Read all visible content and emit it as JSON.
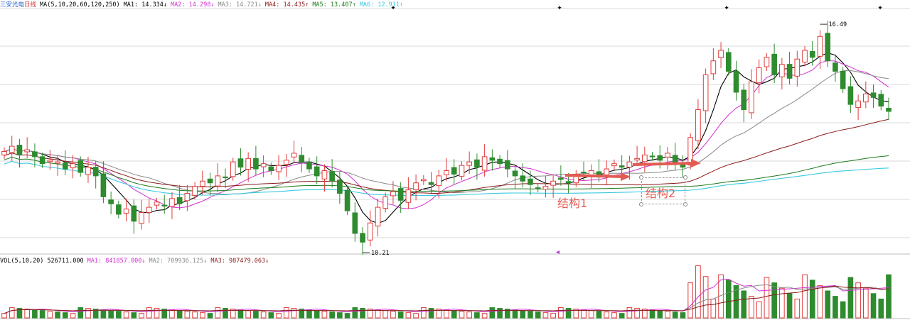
{
  "price_header": {
    "stock_name": "三安光电",
    "period": "日线",
    "ma_def": "MA(5,10,20,60,120,250)",
    "items": [
      {
        "label": "MA1: 14.334",
        "arrow": "↓",
        "color": "#000000"
      },
      {
        "label": "MA2: 14.298",
        "arrow": "↓",
        "color": "#d22fd2"
      },
      {
        "label": "MA3: 14.721",
        "arrow": "↓",
        "color": "#888888"
      },
      {
        "label": "MA4: 14.435",
        "arrow": "↑",
        "color": "#8b1a1a"
      },
      {
        "label": "MA5: 13.407",
        "arrow": "↑",
        "color": "#1b7a1b"
      },
      {
        "label": "MA6: 12.911",
        "arrow": "↑",
        "color": "#39c9e0"
      }
    ]
  },
  "vol_header": {
    "def": "VOL(5,10,20)",
    "value": "526711.000",
    "items": [
      {
        "label": "MA1: 841857.000",
        "arrow": "↓",
        "color": "#d22fd2"
      },
      {
        "label": "MA2: 709936.125",
        "arrow": "↓",
        "color": "#888888"
      },
      {
        "label": "MA3: 987479.063",
        "arrow": "↓",
        "color": "#8b1a1a"
      }
    ]
  },
  "annotations": {
    "structure1": "结构1",
    "structure2": "结构2",
    "high_label": "16.49",
    "low_label": "10.21"
  },
  "colors": {
    "up": "#e23b3b",
    "down": "#2e8b2e",
    "ma1": "#000000",
    "ma2": "#d22fd2",
    "ma3": "#888888",
    "ma4": "#8b1a1a",
    "ma5": "#1b7a1b",
    "ma6": "#39c9e0",
    "arrow": "#e35b52",
    "grid": "#d8d8d8"
  },
  "chart_data": {
    "type": "candlestick",
    "price_range": [
      10.0,
      17.0
    ],
    "candles_close": [
      12.9,
      13.05,
      12.8,
      12.95,
      12.75,
      12.55,
      12.65,
      12.6,
      12.4,
      12.55,
      12.3,
      12.45,
      12.2,
      11.6,
      11.4,
      11.1,
      11.25,
      10.9,
      11.15,
      11.3,
      11.45,
      11.35,
      11.55,
      11.4,
      11.7,
      11.9,
      12.05,
      12.0,
      12.2,
      12.15,
      12.6,
      12.45,
      12.7,
      12.4,
      12.55,
      12.35,
      12.5,
      12.65,
      12.85,
      12.6,
      12.4,
      12.2,
      12.35,
      12.05,
      11.7,
      11.2,
      10.55,
      10.3,
      10.85,
      11.3,
      11.6,
      11.75,
      11.5,
      11.8,
      12.0,
      12.1,
      11.95,
      12.2,
      12.35,
      12.25,
      12.5,
      12.6,
      12.45,
      12.75,
      12.65,
      12.55,
      12.4,
      12.2,
      12.05,
      11.95,
      11.85,
      11.9,
      12.05,
      12.1,
      12.0,
      12.25,
      12.3,
      12.35,
      12.2,
      12.4,
      12.55,
      12.45,
      12.6,
      12.7,
      12.8,
      12.75,
      12.65,
      12.85,
      12.55,
      12.45,
      13.3,
      14.1,
      15.1,
      15.5,
      15.8,
      15.2,
      14.6,
      14.1,
      14.9,
      15.3,
      15.6,
      15.1,
      15.4,
      15.0,
      15.55,
      15.8,
      15.6,
      16.2,
      15.5,
      15.2,
      14.7,
      14.25,
      14.35,
      14.55,
      14.45,
      14.2,
      14.05
    ],
    "ma_lines": [
      "MA1",
      "MA2",
      "MA3",
      "MA4",
      "MA5",
      "MA6"
    ],
    "volume_ylim": [
      0,
      3000000
    ]
  }
}
